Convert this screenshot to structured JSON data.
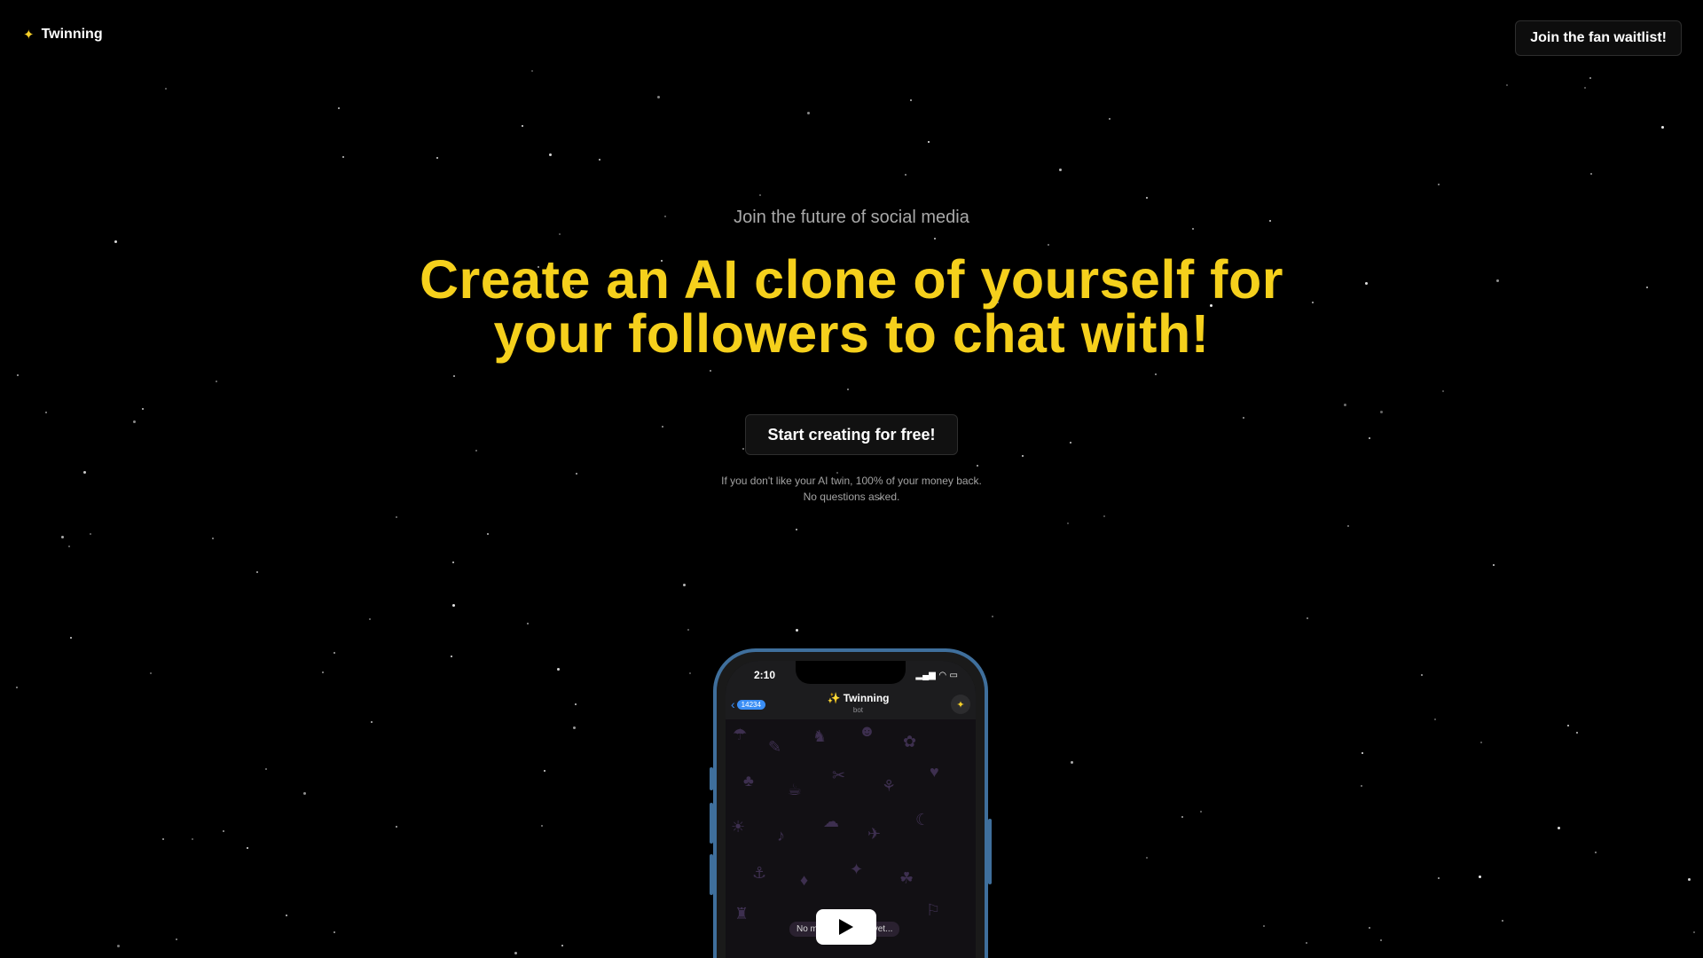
{
  "header": {
    "brand_icon": "sparkles-icon",
    "brand_name": "Twinning",
    "waitlist_button": "Join the fan waitlist!"
  },
  "hero": {
    "eyebrow": "Join the future of social media",
    "headline": "Create an AI clone of yourself for your followers to chat with!",
    "cta_button": "Start creating for free!",
    "guarantee_line1": "If you don't like your AI twin, 100% of your money back.",
    "guarantee_line2": "No questions asked."
  },
  "phone": {
    "time": "2:10",
    "unread_count": "14234",
    "chat_title": "✨ Twinning",
    "chat_subtitle": "bot",
    "empty_message": "No messages here yet...",
    "play_icon": "play-icon"
  },
  "colors": {
    "background": "#000000",
    "headline": "#f5d01c",
    "phone_frame": "#3f6f9c",
    "ios_blue": "#3a8ef5"
  }
}
